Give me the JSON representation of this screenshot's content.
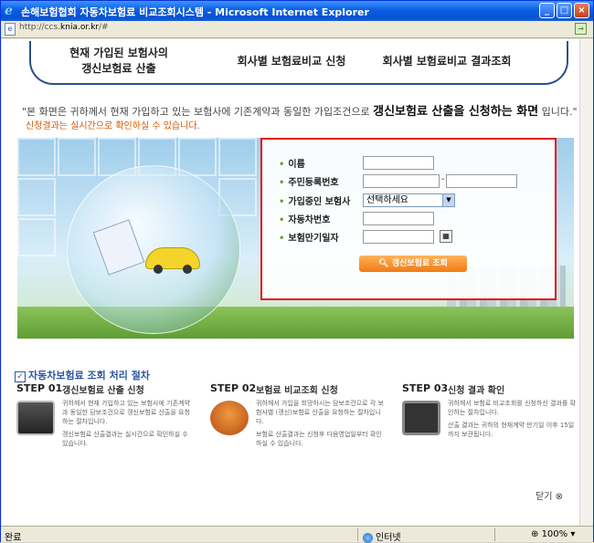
{
  "window": {
    "title": "손해보험협회 자동차보험료 비교조회시스템 - Microsoft Internet Explorer",
    "url_prefix": "http://ccs.",
    "url_domain": "knia.or.kr",
    "url_suffix": "/#"
  },
  "nav": {
    "tabs": [
      {
        "line1": "현재 가입된 보험사의",
        "line2": "갱신보험료 산출"
      },
      {
        "label": "회사별 보험료비교 신청"
      },
      {
        "label": "회사별 보험료비교 결과조회"
      }
    ]
  },
  "intro": {
    "lead": "\"본 화면은 귀하께서 현재 가입하고 있는 보험사에 기존계약과 동일한 가입조건으로",
    "emphasis": "갱신보험료 산출을 신청하는 화면",
    "tail": "입니다.\"",
    "note": "신청결과는 실시간으로 확인하실 수 있습니다."
  },
  "form": {
    "name_label": "이름",
    "rrn_label": "주민등록번호",
    "rrn_separator": "-",
    "company_label": "가입중인 보험사",
    "company_selected": "선택하세요",
    "car_number_label": "자동차번호",
    "expiry_label": "보험만기일자",
    "submit_label": "갱신보험료 조회"
  },
  "process": {
    "title": "자동차보험료 조회 처리 절차",
    "steps": [
      {
        "num": "STEP 01",
        "label": "갱신보험료 산출 신청",
        "desc1": "귀하께서 현재 가입하고 있는 보험사에 기존계약과 동일한 담보조건으로 갱신보험료 산출을 요청하는 절차입니다.",
        "desc2": "갱신보험료 산출결과는 실시간으로 확인하실 수 있습니다."
      },
      {
        "num": "STEP 02",
        "label": "보험료 비교조회 신청",
        "desc1": "귀하께서 가입을 희망하시는 담보조건으로 각 보험사별 (갱신)보험료 산출을 요청하는 절차입니다.",
        "desc2": "보험료 산출결과는 신청후 다음영업일부터 확인하실 수 있습니다."
      },
      {
        "num": "STEP 03",
        "label": "신청 결과 확인",
        "desc1": "귀하께서 보험료 비교조회를 신청하신 결과를 확인하는 절차입니다.",
        "desc2": "산출 결과는 귀하의 현재계약 만기일 이후 15일까지 보관됩니다."
      }
    ],
    "close_label": "닫기"
  },
  "status": {
    "text": "완료",
    "zone": "인터넷",
    "zoom": "100%"
  }
}
